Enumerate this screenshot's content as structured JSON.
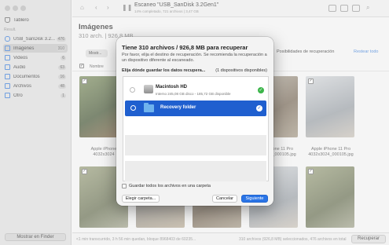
{
  "window": {
    "title": "Escaneo \"USB_SanDisk 3.2Gen1\"",
    "subtitle": "14% completado, 721 archivos | 3,47 GB"
  },
  "sidebar": {
    "top_label": "Tablero",
    "section_label": "Result.",
    "items": [
      {
        "label": "USB_SanDisk 3.2...",
        "count": "476"
      },
      {
        "label": "Imágenes",
        "count": "310"
      },
      {
        "label": "Videos",
        "count": "6"
      },
      {
        "label": "Audio",
        "count": "63"
      },
      {
        "label": "Documentos",
        "count": "16"
      },
      {
        "label": "Archivos",
        "count": "48"
      },
      {
        "label": "Otro",
        "count": "1"
      }
    ],
    "finder_button": "Mostrar en Finder"
  },
  "content": {
    "title": "Imágenes",
    "subtitle": "310 arch. | 926,8 MB",
    "filter_button": "Mostr...",
    "recovery_options": "Posibilidades de recuperación",
    "reset_view": "Restear todo",
    "column_name": "Nombre",
    "select_all_mark": "✓"
  },
  "grid": {
    "captions": [
      {
        "line1": "Apple iPhone",
        "line2": "4032x3024"
      },
      {
        "line1": "Apple iPhone 11 Pro",
        "line2": "4032x3024_000105.jpg"
      },
      {
        "line1": "Apple iPhone 11 Pro",
        "line2": "4032x3024_000105.jpg"
      },
      {
        "line1": "Apple iPhone 11 Pro",
        "line2": "4032x3024_000105.jpg"
      }
    ]
  },
  "status": {
    "left": "<1 min transcurrido, 3 h 56 min quedan, bloque 8968403 de 60235...",
    "right": "310 archivos (926,8 MB) seleccionados, 476 archivos en total",
    "recover_button": "Recuperar"
  },
  "modal": {
    "title": "Tiene 310 archivos / 926,8 MB para recuperar",
    "description": "Por favor, elija el destino de recuperación. Se recomienda la recuperación a un dispositivo diferente al escaneado.",
    "choose_label": "Elija dónde guardar los datos recupera...",
    "available": "(1 dispositivos disponibles)",
    "devices": [
      {
        "name": "Macintosh HD",
        "detail": "Interno 245,08 GB disco - 185,72 GB disponible",
        "ok": "✓"
      },
      {
        "name": "Recovery folder",
        "ok": "✓"
      }
    ],
    "save_all_label": "Guardar todos los archivos en una carpeta",
    "choose_folder": "Elegir carpeta...",
    "cancel": "Cancelar",
    "next": "Siguiente"
  },
  "colors": {
    "accent": "#2a74e6",
    "selected_row": "#1f5fcf",
    "ok_green": "#3cb54a"
  }
}
